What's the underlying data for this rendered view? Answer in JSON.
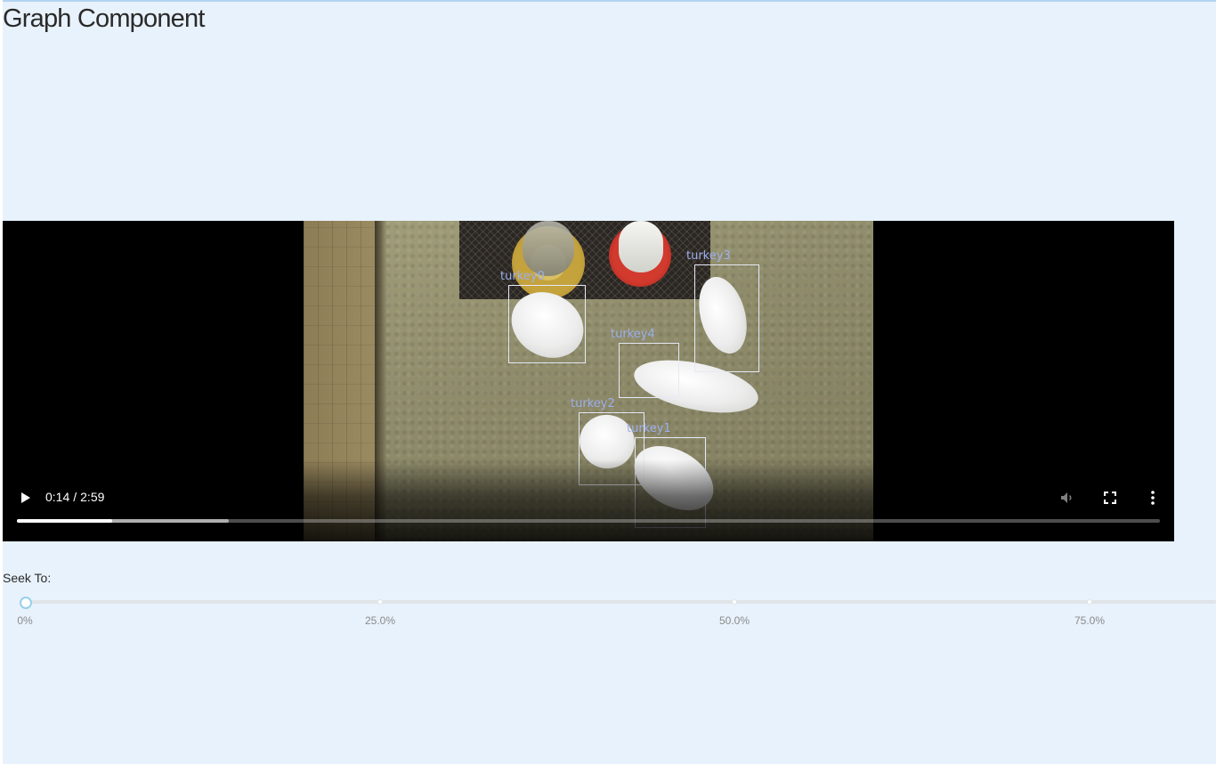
{
  "page": {
    "title": "Graph Component"
  },
  "video": {
    "detections": [
      {
        "label": "turkey0"
      },
      {
        "label": "turkey3"
      },
      {
        "label": "turkey4"
      },
      {
        "label": "turkey2"
      },
      {
        "label": "turkey1"
      }
    ],
    "controls": {
      "current_time": "0:14",
      "duration": "2:59",
      "played_fraction": 0.083,
      "buffered_fraction": 0.185
    },
    "icons": [
      "play-icon",
      "mute-icon",
      "fullscreen-icon",
      "more-options-icon"
    ]
  },
  "seek": {
    "label": "Seek To:",
    "value_percent": 0,
    "marks": [
      "0%",
      "25.0%",
      "50.0%",
      "75.0%"
    ]
  },
  "colors": {
    "page_background": "#e8f2fc",
    "slider_handle_border": "#96d0ec",
    "detection_label": "#9db0ee"
  }
}
